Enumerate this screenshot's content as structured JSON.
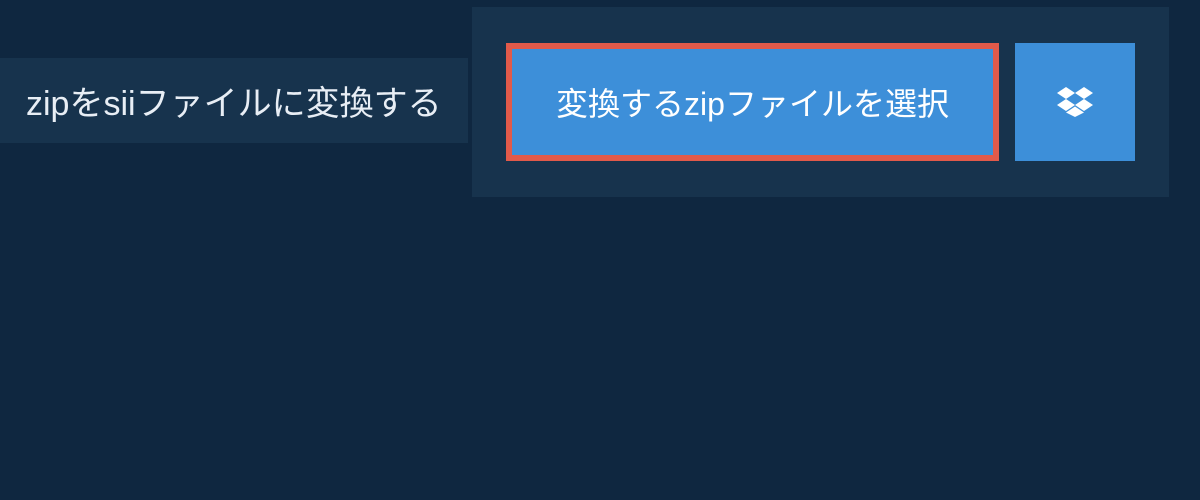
{
  "header": {
    "title": "zipをsiiファイルに変換する"
  },
  "actions": {
    "select_file_label": "変換するzipファイルを選択"
  }
}
